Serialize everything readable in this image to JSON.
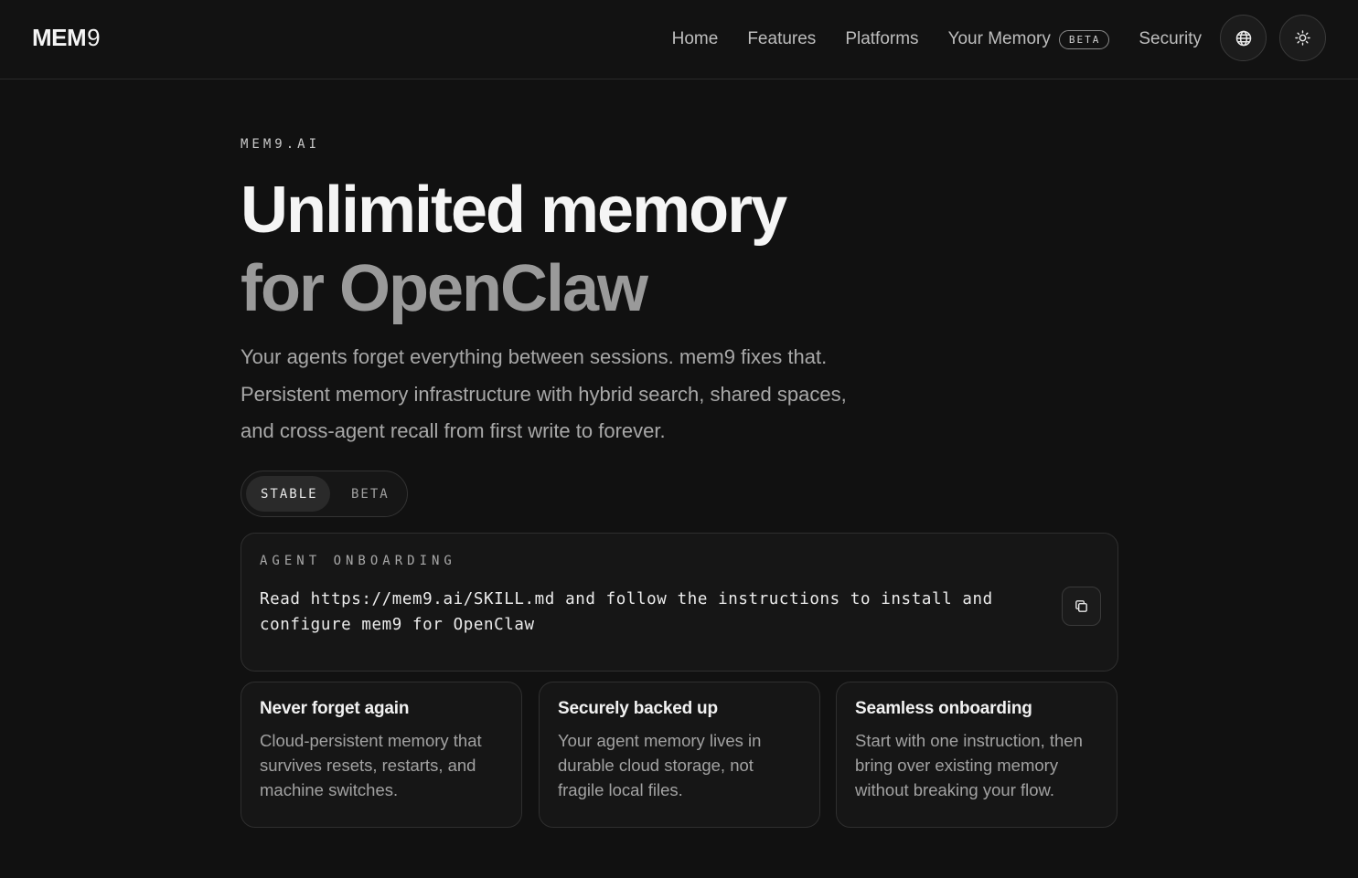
{
  "header": {
    "logo_text": "MEM",
    "logo_nine": "9",
    "nav": [
      {
        "label": "Home"
      },
      {
        "label": "Features"
      },
      {
        "label": "Platforms"
      },
      {
        "label": "Your Memory",
        "badge": "BETA"
      },
      {
        "label": "Security"
      }
    ],
    "icons": {
      "language": "globe-icon",
      "theme": "sun-icon"
    }
  },
  "hero": {
    "eyebrow": "MEM9.AI",
    "title_line1": "Unlimited memory",
    "title_line2": "for OpenClaw",
    "lede_line1": "Your agents forget everything between sessions. mem9 fixes that.",
    "lede_line2": "Persistent memory infrastructure with hybrid search, shared spaces,",
    "lede_line3": "and cross-agent recall from first write to forever."
  },
  "channel_toggle": {
    "options": [
      "STABLE",
      "BETA"
    ],
    "selected": "STABLE"
  },
  "onboarding": {
    "label": "AGENT ONBOARDING",
    "command_line1": "Read https://mem9.ai/SKILL.md and follow the instructions to install and",
    "command_line2": "configure mem9 for OpenClaw",
    "copy_icon": "copy-icon"
  },
  "features": [
    {
      "title": "Never forget again",
      "body": "Cloud-persistent memory that survives resets, restarts, and machine switches."
    },
    {
      "title": "Securely backed up",
      "body": "Your agent memory lives in durable cloud storage, not fragile local files."
    },
    {
      "title": "Seamless onboarding",
      "body": "Start with one instruction, then bring over existing memory without breaking your flow."
    }
  ]
}
